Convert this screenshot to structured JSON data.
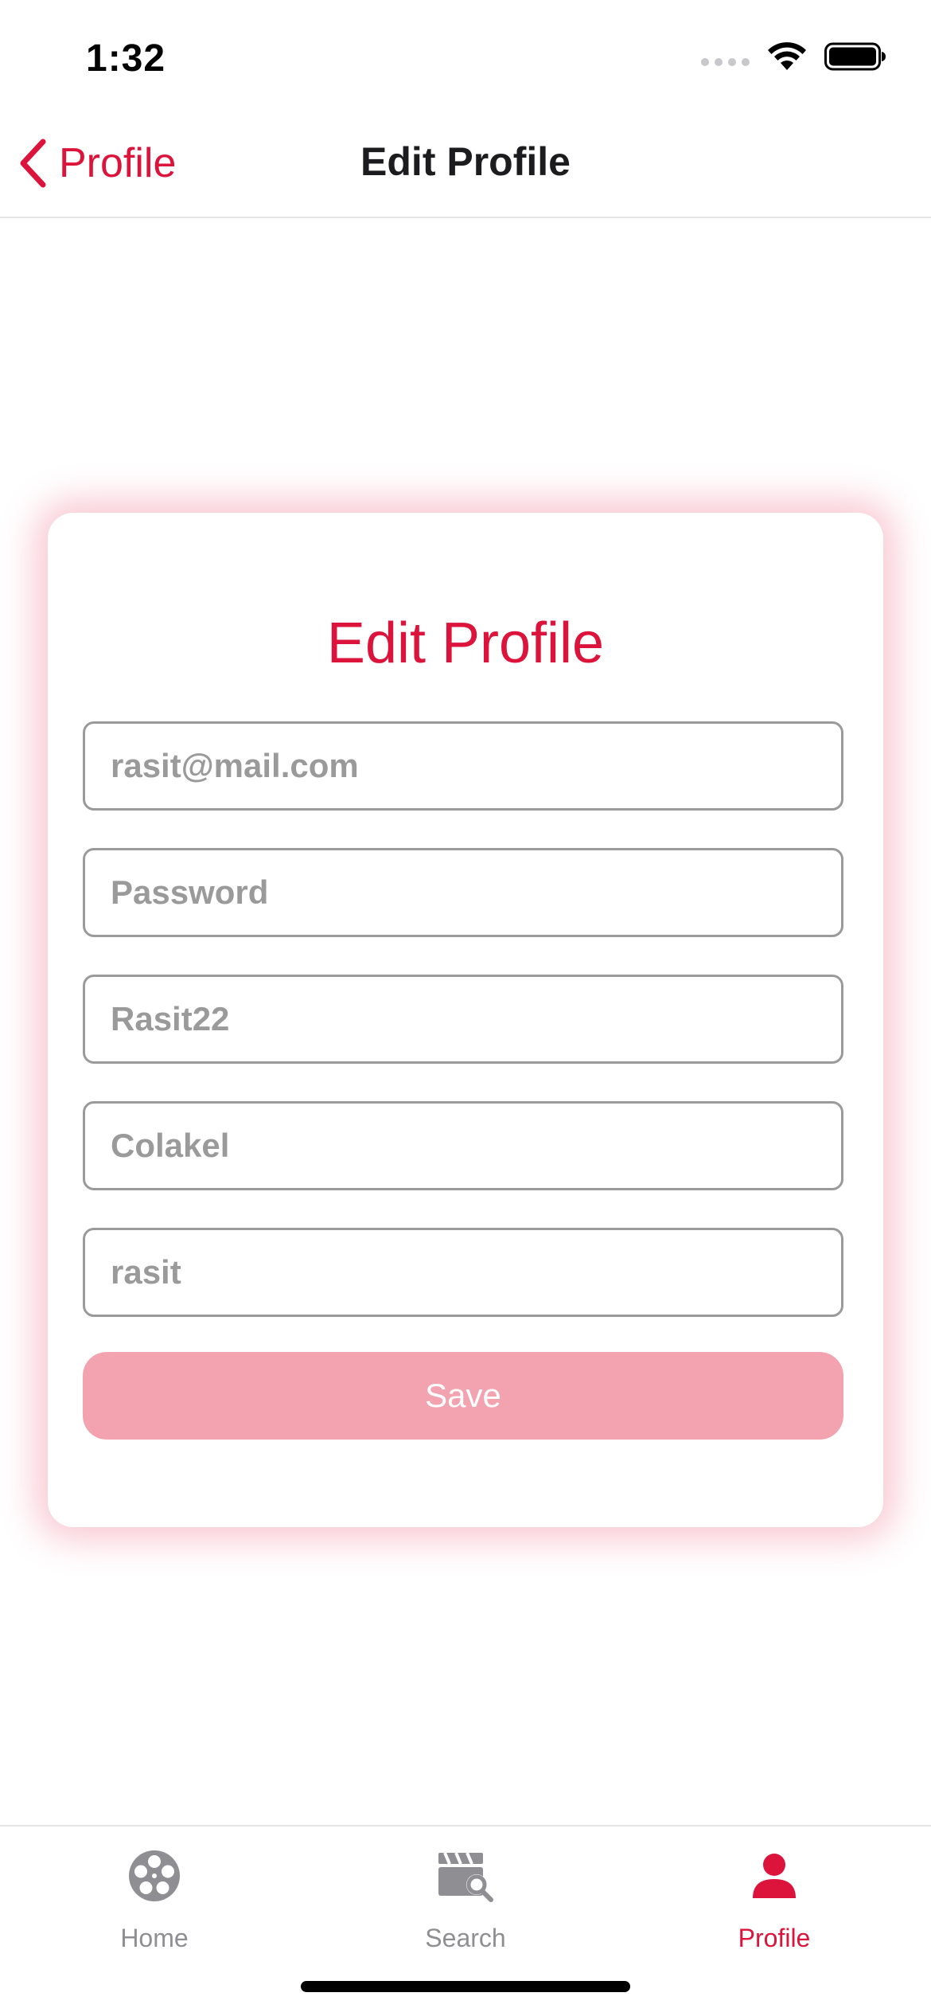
{
  "status_bar": {
    "time": "1:32"
  },
  "nav": {
    "back_label": "Profile",
    "title": "Edit Profile"
  },
  "form": {
    "title": "Edit Profile",
    "fields": [
      {
        "name": "email",
        "placeholder": "rasit@mail.com"
      },
      {
        "name": "password",
        "placeholder": "Password"
      },
      {
        "name": "username",
        "placeholder": "Rasit22"
      },
      {
        "name": "last_name",
        "placeholder": "Colakel"
      },
      {
        "name": "first_name",
        "placeholder": "rasit"
      }
    ],
    "save_label": "Save"
  },
  "tabs": [
    {
      "label": "Home",
      "icon": "film-reel-icon",
      "active": false
    },
    {
      "label": "Search",
      "icon": "clapperboard-search-icon",
      "active": false
    },
    {
      "label": "Profile",
      "icon": "person-icon",
      "active": true
    }
  ],
  "colors": {
    "accent": "#dc143c",
    "button_disabled": "#f3a3af",
    "inactive_tab": "#8e8e93",
    "field_text": "#9a9a9a"
  }
}
